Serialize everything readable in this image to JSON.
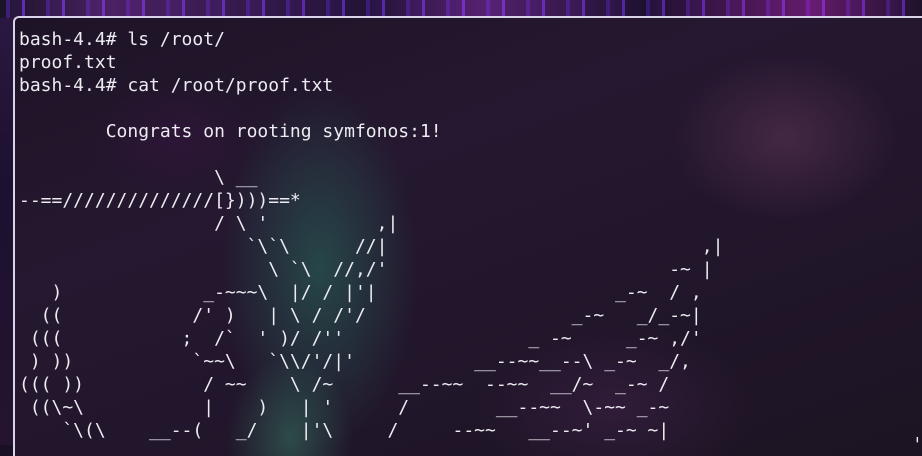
{
  "terminal": {
    "lines": [
      "bash-4.4# ls /root/",
      "proof.txt",
      "bash-4.4# cat /root/proof.txt",
      "",
      "        Congrats on rooting symfonos:1!",
      "",
      "                  \\ __",
      "--==//////////////[})))==*",
      "                  / \\ '          ,|",
      "                     `\\`\\      //|                             ,|",
      "                       \\ `\\  //,/'                          -~ |",
      "   )             _-~~~\\  |/ / |'|                      _-~  / ,",
      "  ((            /' )   | \\ / /'/                   _-~   _/_-~|",
      " (((           ;  /`  ' )/ /''                 _ -~     _-~ ,/'",
      " ) ))           `~~\\   `\\\\/'/|'           __--~~__--\\ _-~  _/,",
      "((( ))           / ~~    \\ /~      __--~~  --~~  __/~  _-~ /",
      " ((\\~\\           |    )   | '      /        __--~~  \\-~~ _-~",
      "    `\\(\\    __--(   _/    |'\\     /     --~~   __--~' _-~ ~|"
    ],
    "corner_glyph": "╻"
  }
}
